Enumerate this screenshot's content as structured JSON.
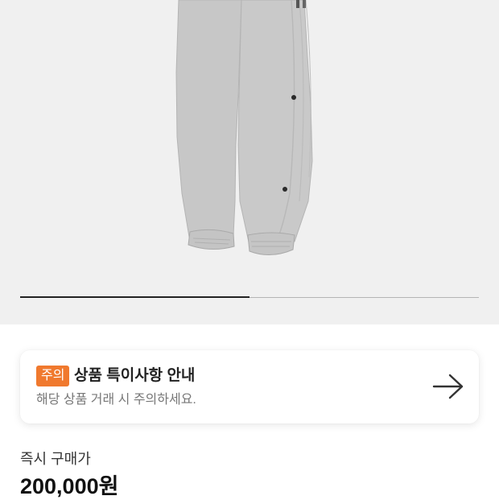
{
  "gallery": {
    "image_icon": "sweatpants-product-image",
    "slide_progress": 0.5
  },
  "notice": {
    "badge": "주의",
    "title": "상품 특이사항 안내",
    "subtitle": "해당 상품 거래 시 주의하세요.",
    "icon": "arrow-right-icon"
  },
  "price": {
    "label": "즉시 구매가",
    "value": "200,000원"
  },
  "colors": {
    "gallery_bg": "#f0f0f0",
    "badge_bg": "#f0792e",
    "text_primary": "#222222",
    "text_secondary": "#777777"
  }
}
